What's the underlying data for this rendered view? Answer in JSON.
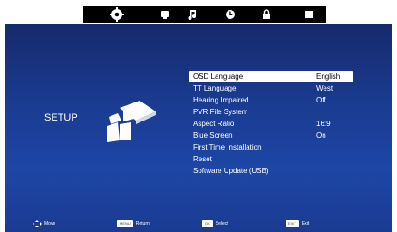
{
  "tabs": [
    {
      "icon": "gear-icon",
      "active": true
    },
    {
      "icon": "tv-icon",
      "active": false
    },
    {
      "icon": "music-note-icon",
      "active": false
    },
    {
      "icon": "clock-icon",
      "active": false
    },
    {
      "icon": "lock-icon",
      "active": false
    },
    {
      "icon": "square-icon",
      "active": false
    }
  ],
  "page": {
    "title": "SETUP"
  },
  "menu": [
    {
      "label": "OSD Language",
      "value": "English",
      "selected": true
    },
    {
      "label": "TT Language",
      "value": "West"
    },
    {
      "label": "Hearing Impaired",
      "value": "Off"
    },
    {
      "label": "PVR File System",
      "value": ""
    },
    {
      "label": "Aspect Ratio",
      "value": "16:9"
    },
    {
      "label": "Blue Screen",
      "value": "On"
    },
    {
      "label": "First Time Installation",
      "value": ""
    },
    {
      "label": "Reset",
      "value": ""
    },
    {
      "label": "Software Update (USB)",
      "value": ""
    }
  ],
  "footer": {
    "move": "Move",
    "menu_key": "MENU",
    "return": "Return",
    "ok_key": "OK",
    "select": "Select",
    "exit_key": "EXIT",
    "exit": "Exit"
  },
  "colors": {
    "background": "#1a3b92",
    "highlight": "#ffffff",
    "topbar": "#000000"
  }
}
